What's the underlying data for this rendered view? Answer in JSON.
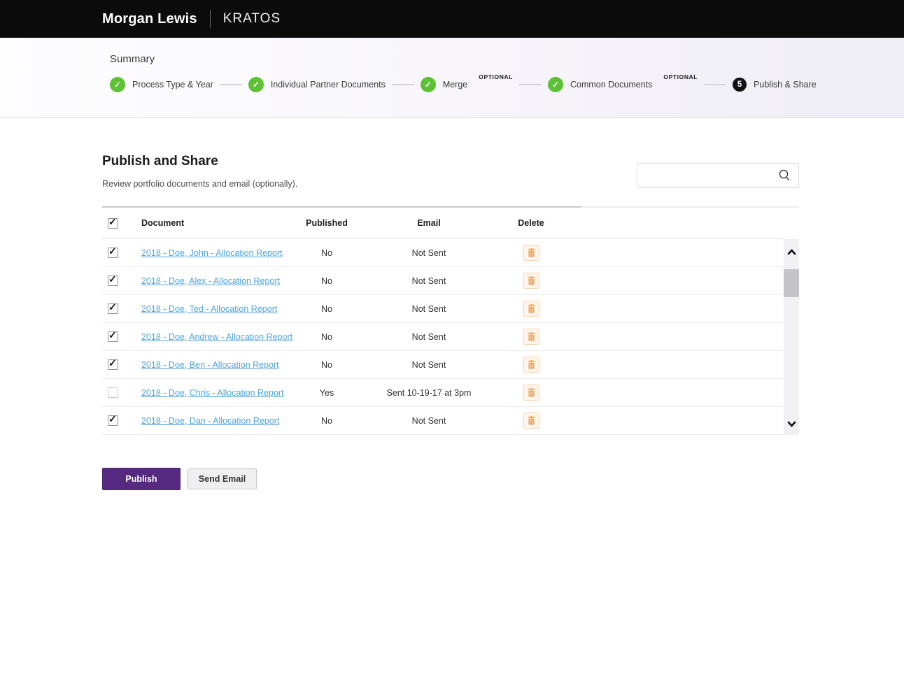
{
  "header": {
    "brand": "Morgan Lewis",
    "product": "KRATOS"
  },
  "stepper": {
    "title": "Summary",
    "steps": [
      {
        "label": "Process Type & Year",
        "state": "complete"
      },
      {
        "label": "Individual Partner Documents",
        "state": "complete"
      },
      {
        "label": "Merge",
        "state": "complete",
        "tag": "OPTIONAL"
      },
      {
        "label": "Common Documents",
        "state": "complete",
        "tag": "OPTIONAL"
      },
      {
        "label": "Publish & Share",
        "state": "current",
        "number": "5"
      }
    ]
  },
  "main": {
    "title": "Publish and Share",
    "subtitle": "Review portfolio documents and email (optionally).",
    "search": {
      "value": "",
      "placeholder": ""
    },
    "table": {
      "columns": [
        "Document",
        "Published",
        "Email",
        "Delete"
      ],
      "select_all_checked": true,
      "rows": [
        {
          "checked": true,
          "document": "2018 - Doe, John - Allocation Report",
          "published": "No",
          "email": "Not Sent"
        },
        {
          "checked": true,
          "document": "2018 - Doe, Alex - Allocation Report",
          "published": "No",
          "email": "Not Sent"
        },
        {
          "checked": true,
          "document": "2018 - Doe, Ted - Allocation Report",
          "published": "No",
          "email": "Not Sent"
        },
        {
          "checked": true,
          "document": "2018 - Doe, Andrew - Allocation Report",
          "published": "No",
          "email": "Not Sent"
        },
        {
          "checked": true,
          "document": "2018 - Doe, Ben - Allocation Report",
          "published": "No",
          "email": "Not Sent"
        },
        {
          "checked": false,
          "document": "2018 - Doe, Chris - Allocation Report",
          "published": "Yes",
          "email": "Sent 10-19-17 at 3pm"
        },
        {
          "checked": true,
          "document": "2018 - Doe, Dan - Allocation Report",
          "published": "No",
          "email": "Not Sent"
        }
      ]
    },
    "buttons": {
      "publish": "Publish",
      "send_email": "Send Email"
    }
  },
  "colors": {
    "step_complete_green": "#5cc234",
    "step_current_black": "#111111",
    "publish_purple": "#552a80",
    "link_blue": "#4fa3df",
    "trash_orange": "#f2a45f",
    "topbar_black": "#0b0b0b"
  }
}
